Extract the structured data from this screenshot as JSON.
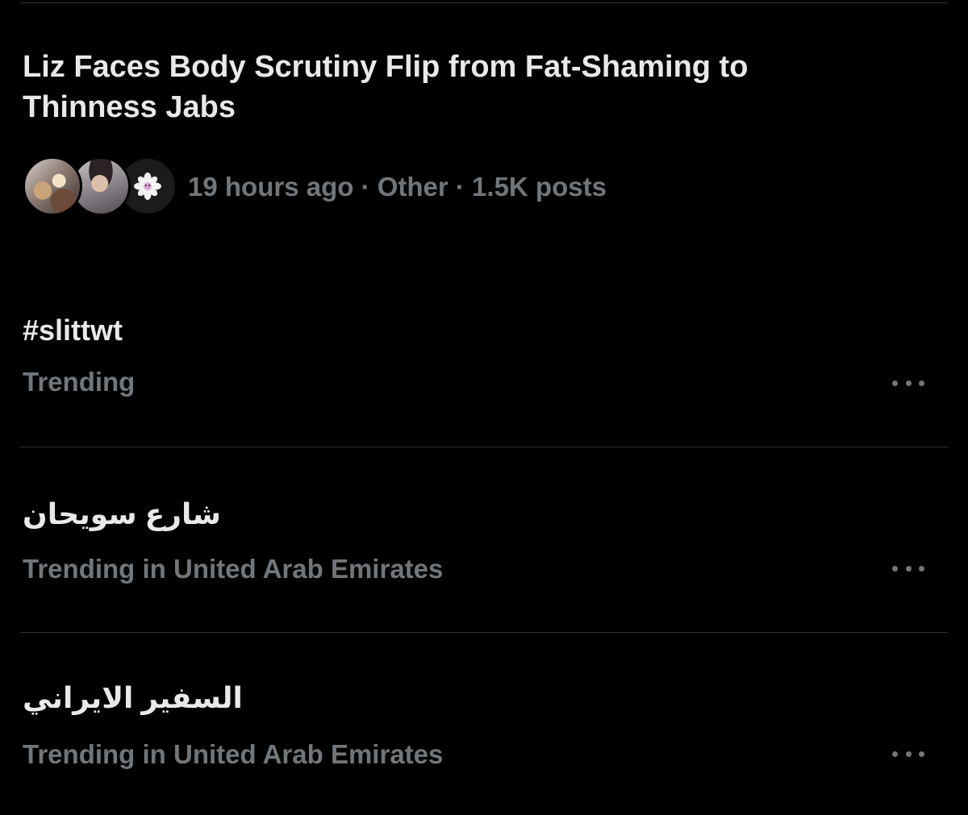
{
  "news": {
    "title": "Liz Faces Body Scrutiny Flip from Fat-Shaming to Thinness Jabs",
    "meta": "19 hours ago · Other · 1.5K posts"
  },
  "trends": [
    {
      "name": "#slittwt",
      "context": "Trending"
    },
    {
      "name": "شارع سويحان",
      "context": "Trending in United Arab Emirates"
    },
    {
      "name": "السفير الايراني",
      "context": "Trending in United Arab Emirates"
    }
  ],
  "icons": {
    "more": "more-options-icon",
    "avatar_flower": "flower-icon"
  },
  "colors": {
    "background": "#000000",
    "primary_text": "#e7e9ea",
    "secondary_text": "#71767b",
    "divider": "#2f3336"
  }
}
